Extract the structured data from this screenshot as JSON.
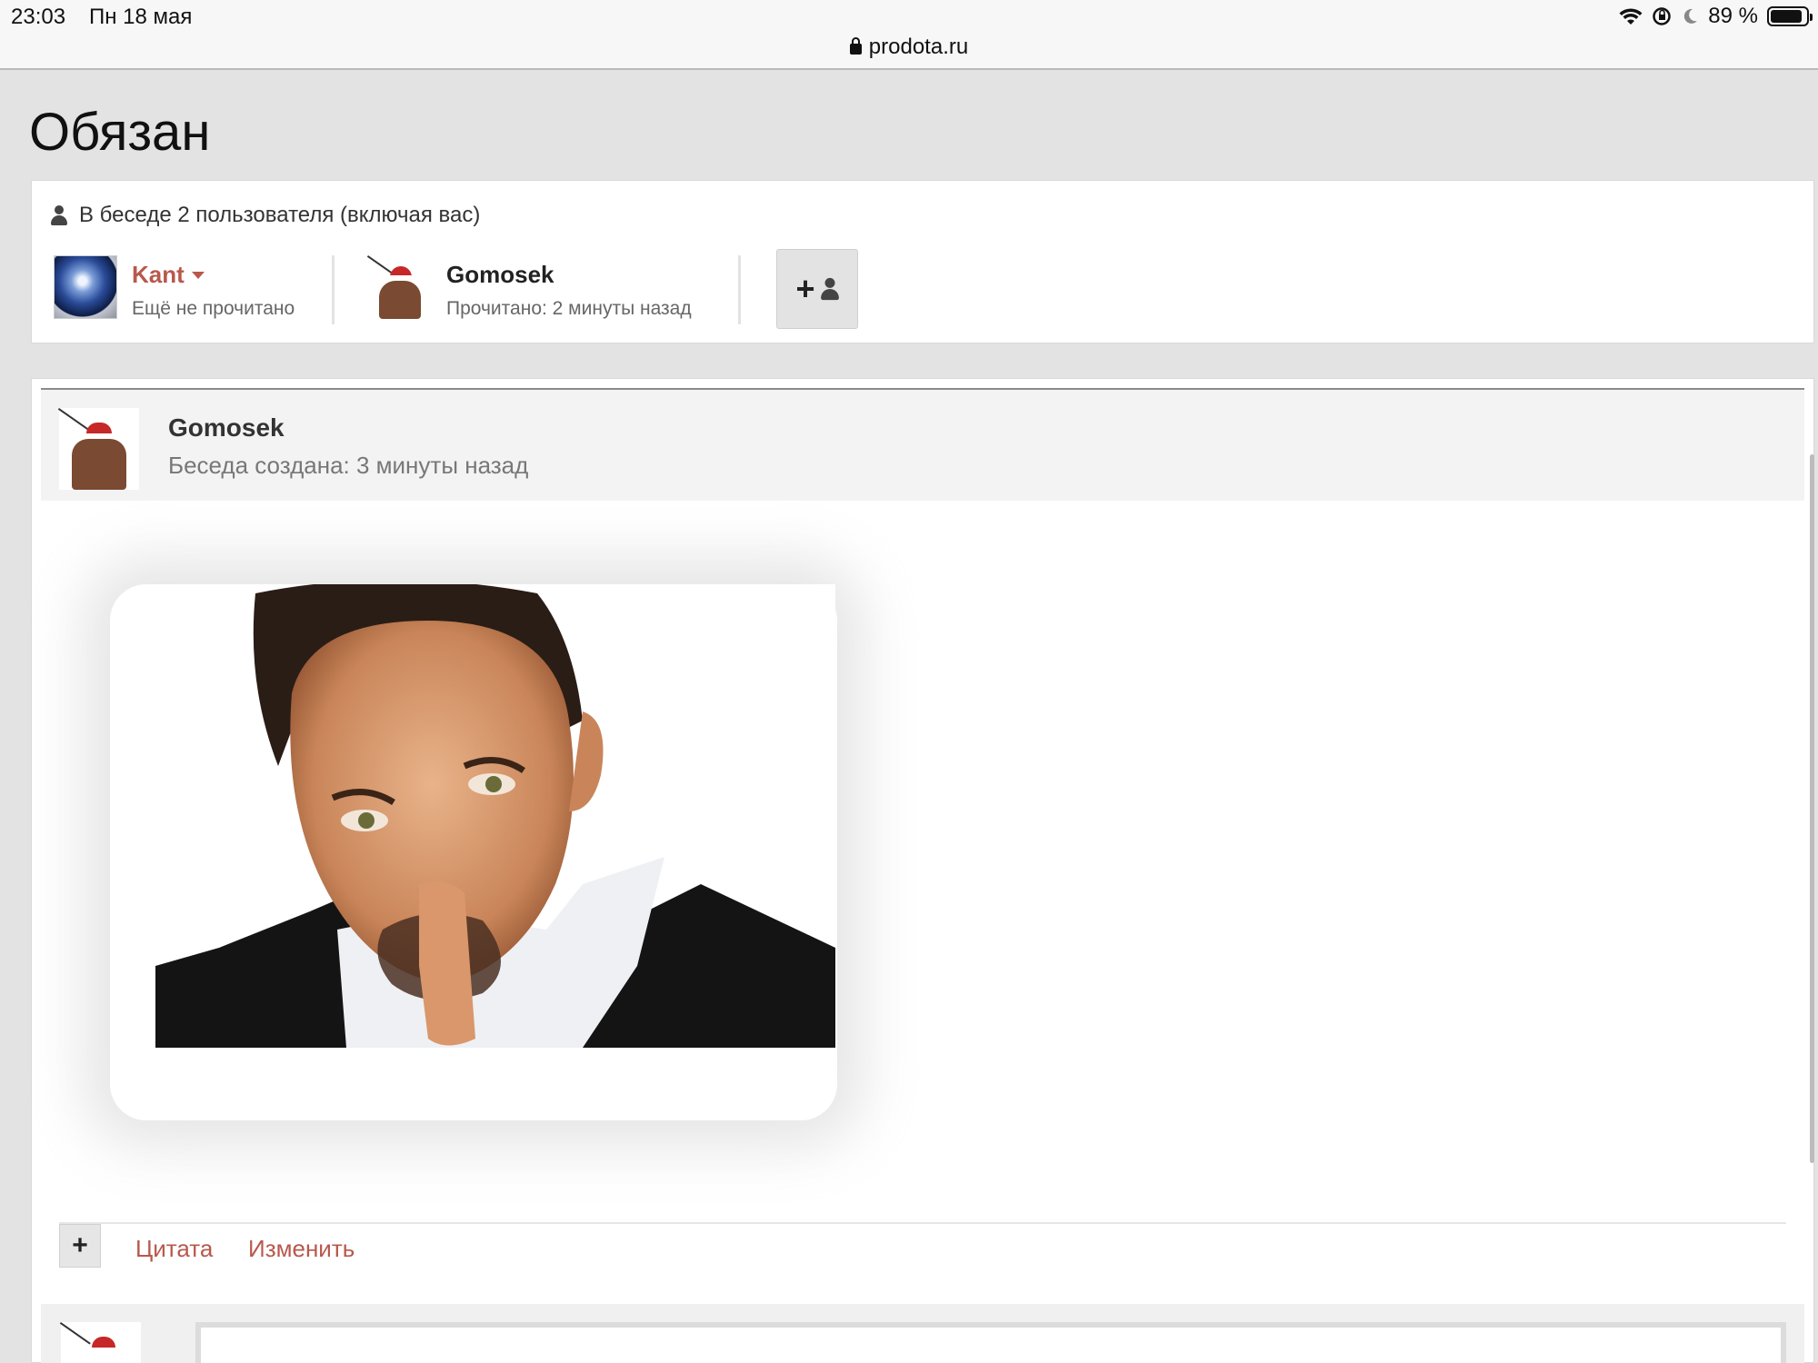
{
  "status_bar": {
    "time": "23:03",
    "date": "Пн 18 мая",
    "battery": "89 %",
    "battery_level": 0.89,
    "icons": [
      "wifi-icon",
      "orientation-lock-icon",
      "moon-icon",
      "battery-icon"
    ]
  },
  "url_bar": {
    "domain": "prodota.ru"
  },
  "page": {
    "title": "Обязан"
  },
  "participants": {
    "heading": "В беседе 2 пользователя (включая вас)",
    "members": [
      {
        "name": "Kant",
        "status": "Ещё не прочитано"
      },
      {
        "name": "Gomosek",
        "status": "Прочитано: 2 минуты назад"
      }
    ]
  },
  "message": {
    "author": "Gomosek",
    "created": "Беседа создана: 3 минуты назад",
    "actions": {
      "plus": "+",
      "quote": "Цитата",
      "edit": "Изменить"
    }
  },
  "colors": {
    "accent": "#b8584c",
    "background": "#e3e3e3",
    "panel": "#ffffff"
  }
}
